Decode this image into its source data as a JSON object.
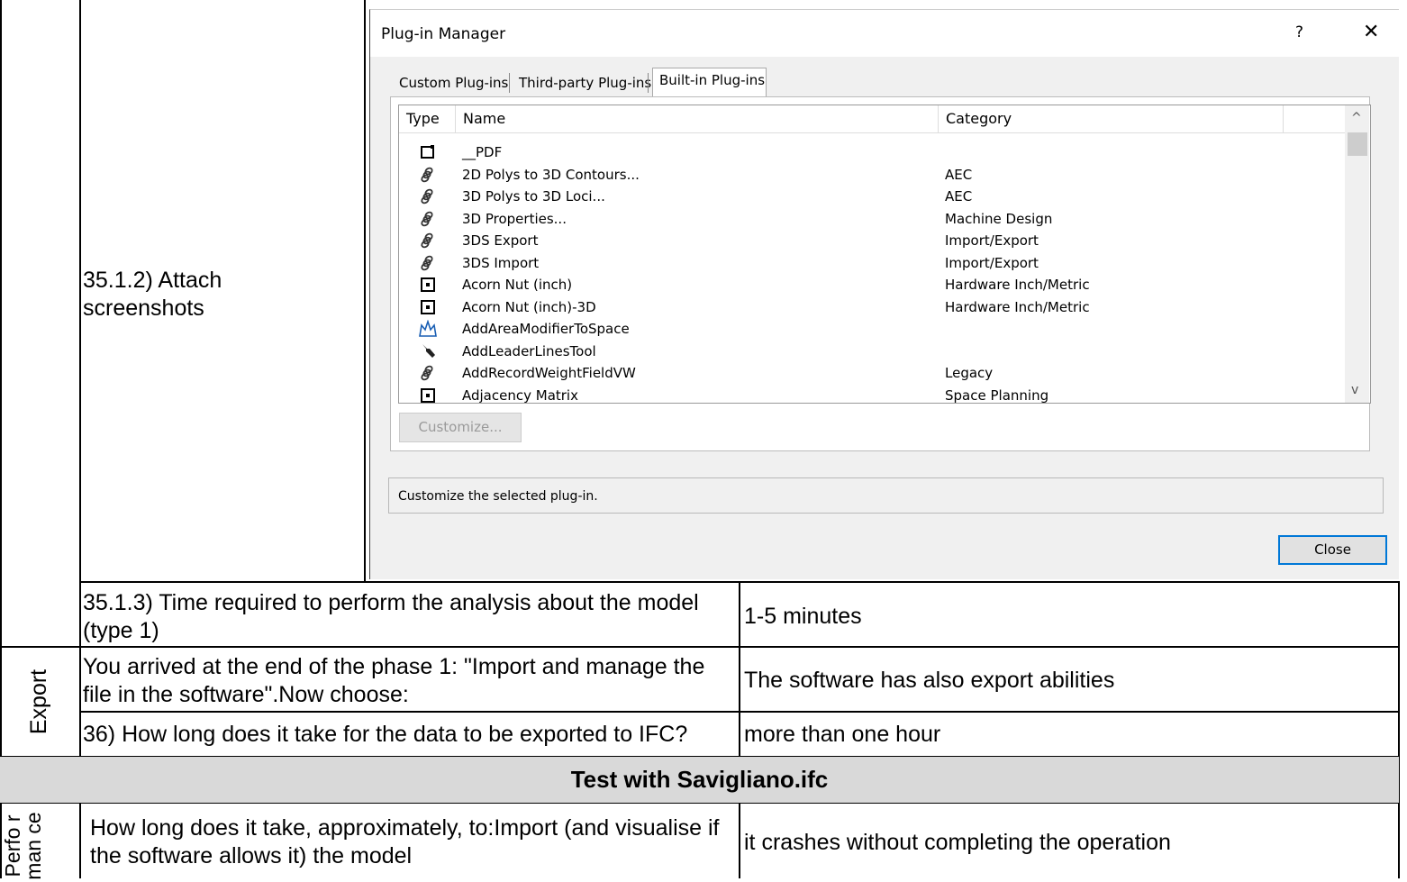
{
  "table": {
    "r1_question": "35.1.2) Attach screenshots",
    "r2_question": "35.1.3) Time required to perform the analysis about the model (type 1)",
    "r2_answer": "1-5 minutes",
    "export_label": "Export",
    "r3_question": "You arrived at the end of the phase 1: \"Import and manage the file in the software\".Now choose:",
    "r3_answer": "The software has also export abilities",
    "r4_question": "36) How long does it take for the data to be exported to IFC?",
    "r4_answer": "more than one hour",
    "section_title": "Test with Savigliano.ifc",
    "perf_label": "Perfo rman ce",
    "r5_question": "How long does it take, approximately, to:Import (and visualise if the software allows it) the model",
    "r5_answer": "it crashes without completing the operation"
  },
  "dialog": {
    "title": "Plug-in Manager",
    "help": "?",
    "close_x": "✕",
    "tabs": [
      "Custom Plug-ins",
      "Third-party Plug-ins",
      "Built-in Plug-ins"
    ],
    "columns": [
      "Type",
      "Name",
      "Category"
    ],
    "rows": [
      {
        "icon": "pdf-plugin-icon",
        "name": "__PDF",
        "category": ""
      },
      {
        "icon": "chain-link-icon",
        "name": "2D Polys to 3D Contours...",
        "category": "AEC"
      },
      {
        "icon": "chain-link-icon",
        "name": "3D Polys to 3D Loci...",
        "category": "AEC"
      },
      {
        "icon": "chain-link-icon",
        "name": "3D Properties...",
        "category": "Machine Design"
      },
      {
        "icon": "chain-link-icon",
        "name": "3DS Export",
        "category": "Import/Export"
      },
      {
        "icon": "chain-link-icon",
        "name": "3DS Import",
        "category": "Import/Export"
      },
      {
        "icon": "object-plugin-icon",
        "name": "Acorn Nut (inch)",
        "category": "Hardware Inch/Metric"
      },
      {
        "icon": "object-plugin-icon",
        "name": "Acorn Nut (inch)-3D",
        "category": "Hardware Inch/Metric"
      },
      {
        "icon": "area-modifier-icon",
        "name": "AddAreaModifierToSpace",
        "category": ""
      },
      {
        "icon": "wrench-icon",
        "name": "AddLeaderLinesTool",
        "category": ""
      },
      {
        "icon": "chain-link-icon",
        "name": "AddRecordWeightFieldVW",
        "category": "Legacy"
      },
      {
        "icon": "object-plugin-icon",
        "name": "Adjacency Matrix",
        "category": "Space Planning"
      }
    ],
    "customize_label": "Customize...",
    "status_text": "Customize the selected plug-in.",
    "close_label": "Close",
    "scroll_up": "^",
    "scroll_down": "v"
  }
}
